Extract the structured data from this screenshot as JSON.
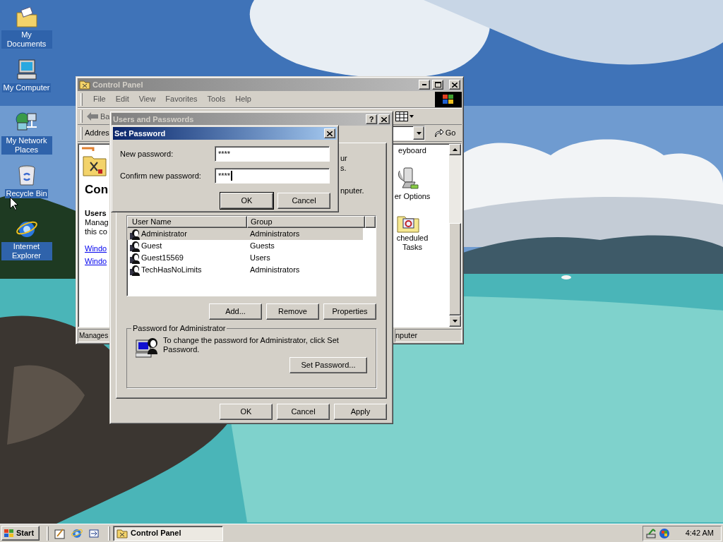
{
  "desktop": {
    "icons": [
      {
        "label": "My Documents",
        "kind": "documents"
      },
      {
        "label": "My Computer",
        "kind": "computer"
      },
      {
        "label": "My Network Places",
        "kind": "network"
      },
      {
        "label": "Recycle Bin",
        "kind": "recycle"
      },
      {
        "label": "Internet Explorer",
        "kind": "browser"
      }
    ]
  },
  "control_panel": {
    "title": "Control Panel",
    "menu": [
      "File",
      "Edit",
      "View",
      "Favorites",
      "Tools",
      "Help"
    ],
    "back": "Ba",
    "address_label": "Addres",
    "go": "Go",
    "left_pane": {
      "title": "Con",
      "heading": "Users",
      "text": [
        "Manag",
        "this co"
      ],
      "links": [
        "Windo",
        "Windo"
      ]
    },
    "items": [
      {
        "label": "eyboard",
        "kind": "none"
      },
      {
        "label": "er Options",
        "kind": "power"
      },
      {
        "label": "cheduled Tasks",
        "kind": "tasks"
      }
    ],
    "status": [
      "Manages",
      "nputer"
    ]
  },
  "users_dialog": {
    "title": "Users and Passwords",
    "help_button": "?",
    "intro_fragments": [
      "ur",
      "s.",
      "nputer."
    ],
    "columns": [
      "User Name",
      "Group"
    ],
    "rows": [
      {
        "name": "Administrator",
        "group": "Administrators",
        "selected": true
      },
      {
        "name": "Guest",
        "group": "Guests",
        "selected": false
      },
      {
        "name": "Guest15569",
        "group": "Users",
        "selected": false
      },
      {
        "name": "TechHasNoLimits",
        "group": "Administrators",
        "selected": false
      }
    ],
    "buttons": [
      "Add...",
      "Remove",
      "Properties"
    ],
    "password_group": {
      "title": "Password for Administrator",
      "text": "To change the password for Administrator, click Set Password.",
      "button": "Set Password..."
    },
    "footer_buttons": [
      "OK",
      "Cancel",
      "Apply"
    ]
  },
  "set_password": {
    "title": "Set Password",
    "fields": [
      {
        "label": "New password:",
        "value": "****",
        "focused": false
      },
      {
        "label": "Confirm new password:",
        "value": "****",
        "focused": true
      }
    ],
    "buttons": [
      {
        "label": "OK",
        "default": true
      },
      {
        "label": "Cancel",
        "default": false
      }
    ]
  },
  "taskbar": {
    "start": "Start",
    "tasks": [
      {
        "label": "Control Panel",
        "selected": true
      }
    ],
    "clock": "4:42 AM"
  }
}
